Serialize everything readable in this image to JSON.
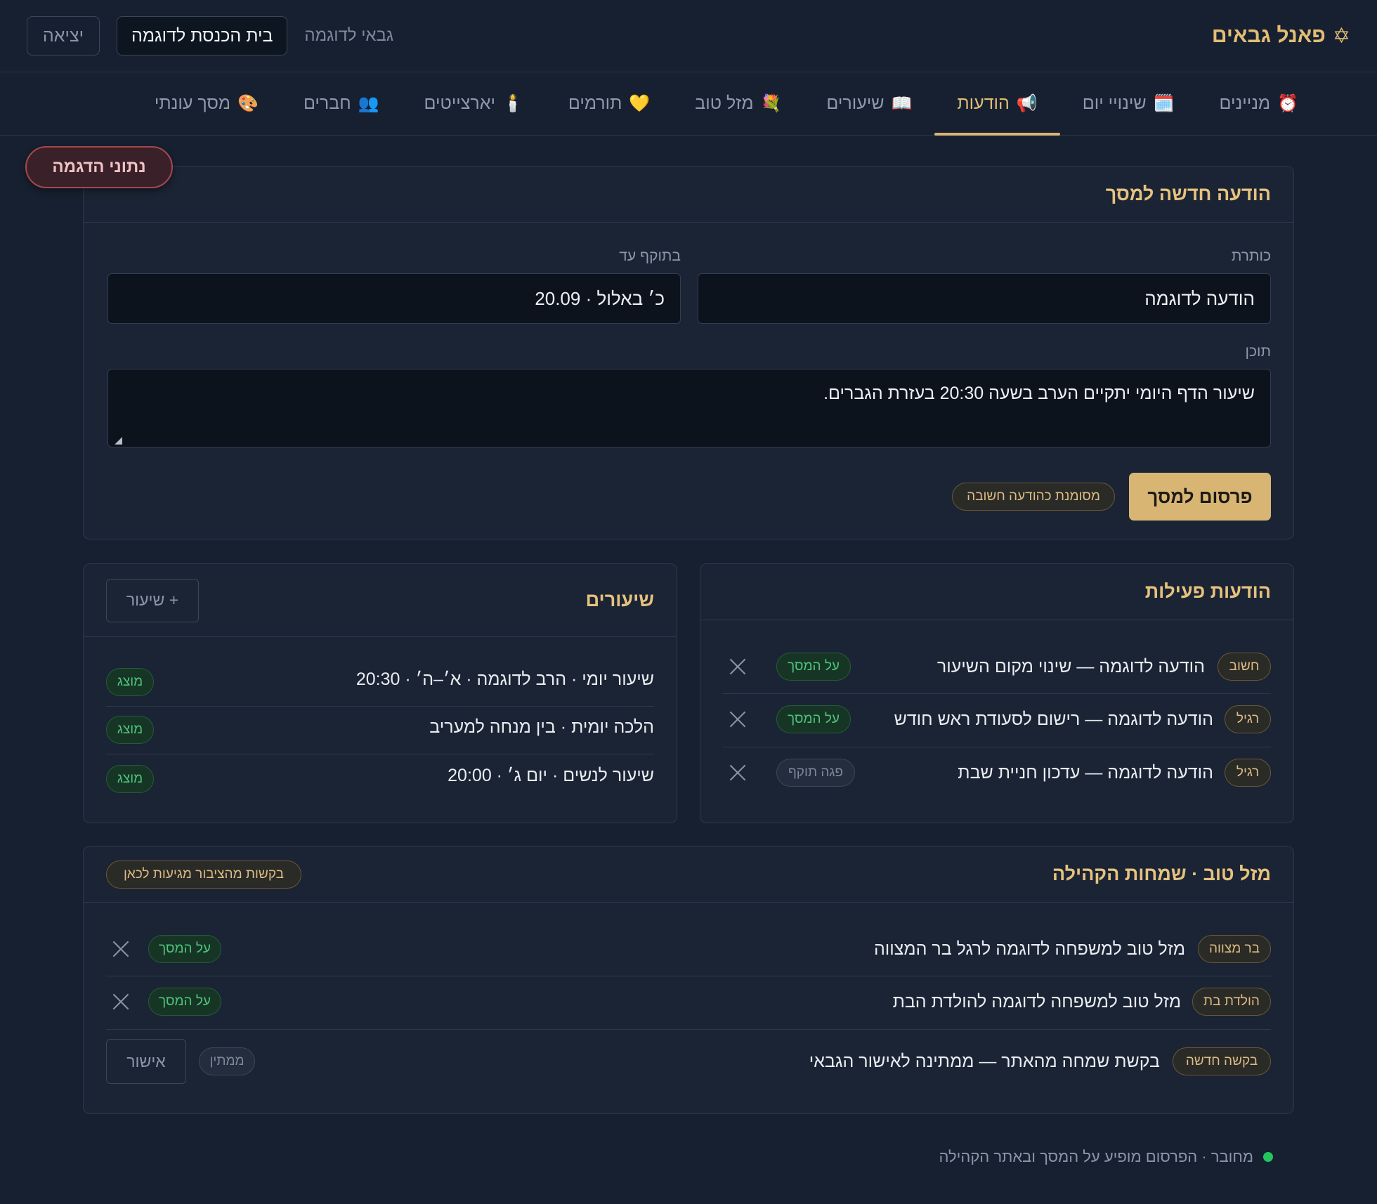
{
  "header": {
    "brand": "פאנל גבאים",
    "brand_icon": "✡",
    "gabai_label": "גבאי לדוגמה",
    "synagogue_button": "בית הכנסת לדוגמה",
    "logout_button": "יציאה"
  },
  "tabs": [
    {
      "label": "מניינים",
      "icon": "⏰"
    },
    {
      "label": "שינויי יום",
      "icon": "🗓️"
    },
    {
      "label": "הודעות",
      "icon": "📢",
      "active": true
    },
    {
      "label": "שיעורים",
      "icon": "📖"
    },
    {
      "label": "מזל טוב",
      "icon": "💐"
    },
    {
      "label": "תורמים",
      "icon": "💛"
    },
    {
      "label": "יארצייטים",
      "icon": "🕯️"
    },
    {
      "label": "חברים",
      "icon": "👥"
    },
    {
      "label": "מסך עונתי",
      "icon": "🎨"
    }
  ],
  "demo_badge": "נתוני הדגמה",
  "new_announcement": {
    "title": "הודעה חדשה למסך",
    "title_label": "כותרת",
    "title_value": "הודעה לדוגמה",
    "valid_until_label": "בתוקף עד",
    "valid_until_value": "כ׳ באלול · 20.09",
    "content_label": "תוכן",
    "content_value": "שיעור הדף היומי יתקיים הערב בשעה 20:30 בעזרת הגברים.",
    "publish_button": "פרסום למסך",
    "important_badge": "מסומנת כהודעה חשובה"
  },
  "active_announcements": {
    "title": "הודעות פעילות",
    "items": [
      {
        "tag": "חשוב",
        "text": "הודעה לדוגמה — שינוי מקום השיעור",
        "status": "על המסך"
      },
      {
        "tag": "רגיל",
        "text": "הודעה לדוגמה — רישום לסעודת ראש חודש",
        "status": "על המסך"
      },
      {
        "tag": "רגיל",
        "text": "הודעה לדוגמה — עדכון חניית שבת",
        "status": "פגה תוקף"
      }
    ]
  },
  "lessons": {
    "title": "שיעורים",
    "add_button": "+ שיעור",
    "items": [
      {
        "text": "שיעור יומי · הרב לדוגמה · א׳–ה׳ · 20:30",
        "status": "מוצג"
      },
      {
        "text": "הלכה יומית · בין מנחה למעריב",
        "status": "מוצג"
      },
      {
        "text": "שיעור לנשים · יום ג׳ · 20:00",
        "status": "מוצג"
      }
    ]
  },
  "mazal_tov": {
    "title": "מזל טוב · שמחות הקהילה",
    "requests_badge": "בקשות מהציבור מגיעות לכאן",
    "items": [
      {
        "tag": "בר מצווה",
        "text": "מזל טוב למשפחה לדוגמה לרגל בר המצווה",
        "status": "על המסך"
      },
      {
        "tag": "הולדת בת",
        "text": "מזל טוב למשפחה לדוגמה להולדת הבת",
        "status": "על המסך"
      },
      {
        "tag": "בקשה חדשה",
        "text": "בקשת שמחה מהאתר — ממתינה לאישור הגבאי",
        "status": "ממתין",
        "action": "אישור"
      }
    ]
  },
  "status_line": "מחובר · הפרסום מופיע על המסך ובאתר הקהילה",
  "colors": {
    "background": "#172030",
    "accent": "#d9b574",
    "on_screen": "#4cc57c",
    "connected": "#22c55e"
  }
}
